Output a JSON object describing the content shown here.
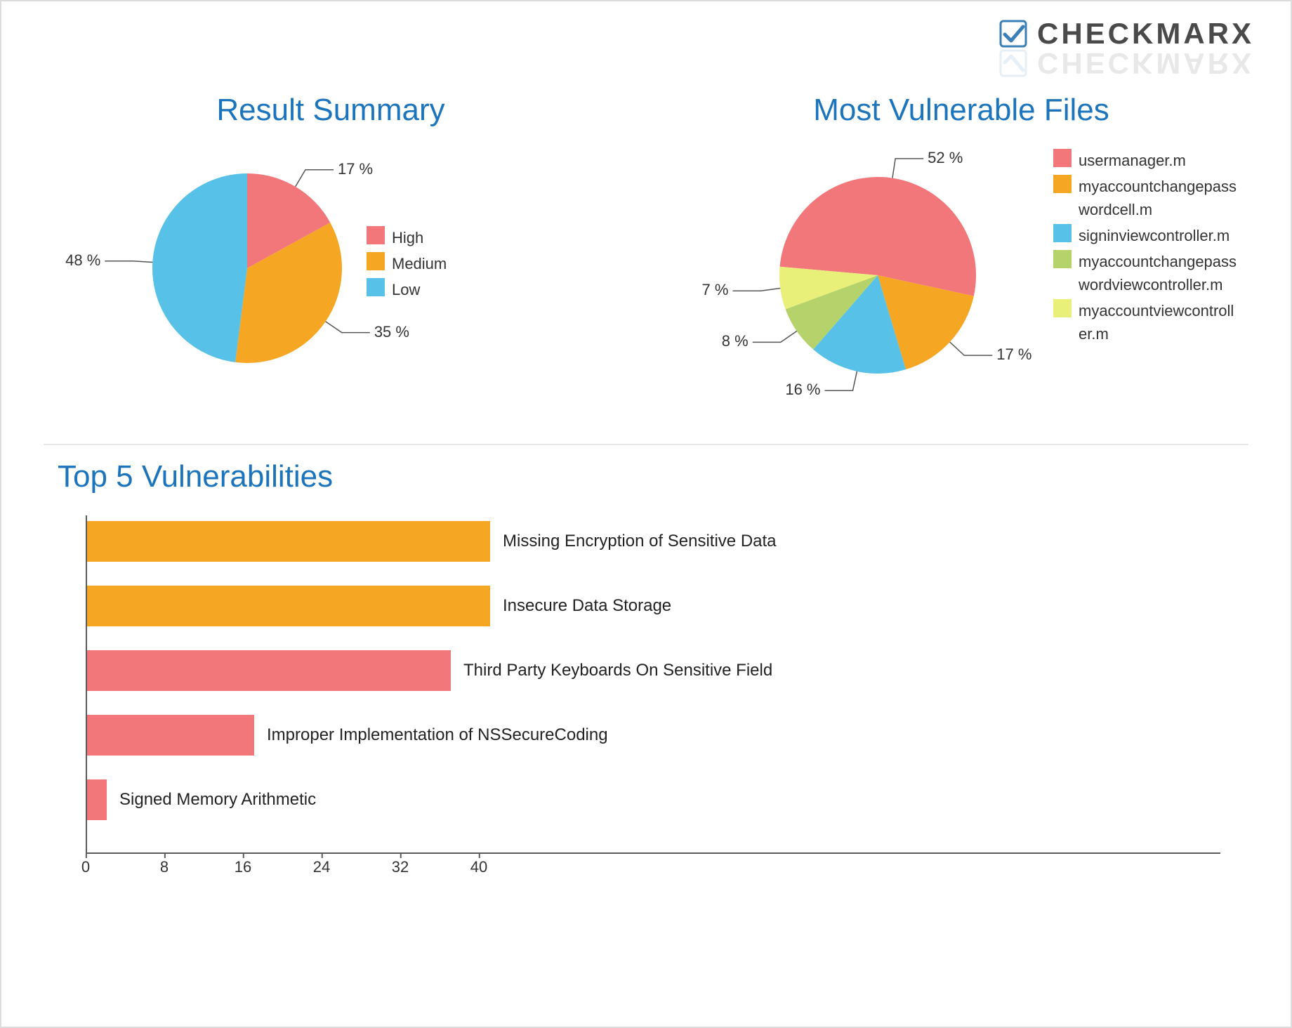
{
  "brand": {
    "name": "CHECKMARX"
  },
  "chart_data": [
    {
      "id": "result_summary",
      "type": "pie",
      "title": "Result Summary",
      "series": [
        {
          "name": "High",
          "value": 17,
          "color": "#f2777a"
        },
        {
          "name": "Medium",
          "value": 35,
          "color": "#f5a623"
        },
        {
          "name": "Low",
          "value": 48,
          "color": "#57c1e8"
        }
      ],
      "value_unit": "%"
    },
    {
      "id": "most_vulnerable_files",
      "type": "pie",
      "title": "Most Vulnerable Files",
      "series": [
        {
          "name": "usermanager.m",
          "value": 52,
          "color": "#f2777a"
        },
        {
          "name": "myaccountchangepasswordcell.m",
          "value": 17,
          "color": "#f5a623"
        },
        {
          "name": "signinviewcontroller.m",
          "value": 16,
          "color": "#57c1e8"
        },
        {
          "name": "myaccountchangepasswordviewcontroller.m",
          "value": 8,
          "color": "#b5d36a"
        },
        {
          "name": "myaccountviewcontroller.m",
          "value": 7,
          "color": "#e8f07a"
        }
      ],
      "value_unit": "%"
    },
    {
      "id": "top5_vulnerabilities",
      "type": "bar",
      "orientation": "horizontal",
      "title": "Top 5 Vulnerabilities",
      "xlabel": "",
      "ylabel": "",
      "xlim": [
        0,
        44
      ],
      "xticks": [
        0,
        8,
        16,
        24,
        32,
        40
      ],
      "series": [
        {
          "name": "Missing Encryption of Sensitive Data",
          "value": 41,
          "color": "#f5a623"
        },
        {
          "name": "Insecure Data Storage",
          "value": 41,
          "color": "#f5a623"
        },
        {
          "name": "Third Party Keyboards On Sensitive Field",
          "value": 37,
          "color": "#f2777a"
        },
        {
          "name": "Improper Implementation of NSSecureCoding",
          "value": 17,
          "color": "#f2777a"
        },
        {
          "name": "Signed Memory Arithmetic",
          "value": 2,
          "color": "#f2777a"
        }
      ]
    }
  ],
  "labels": {
    "pct_suffix": " %"
  }
}
